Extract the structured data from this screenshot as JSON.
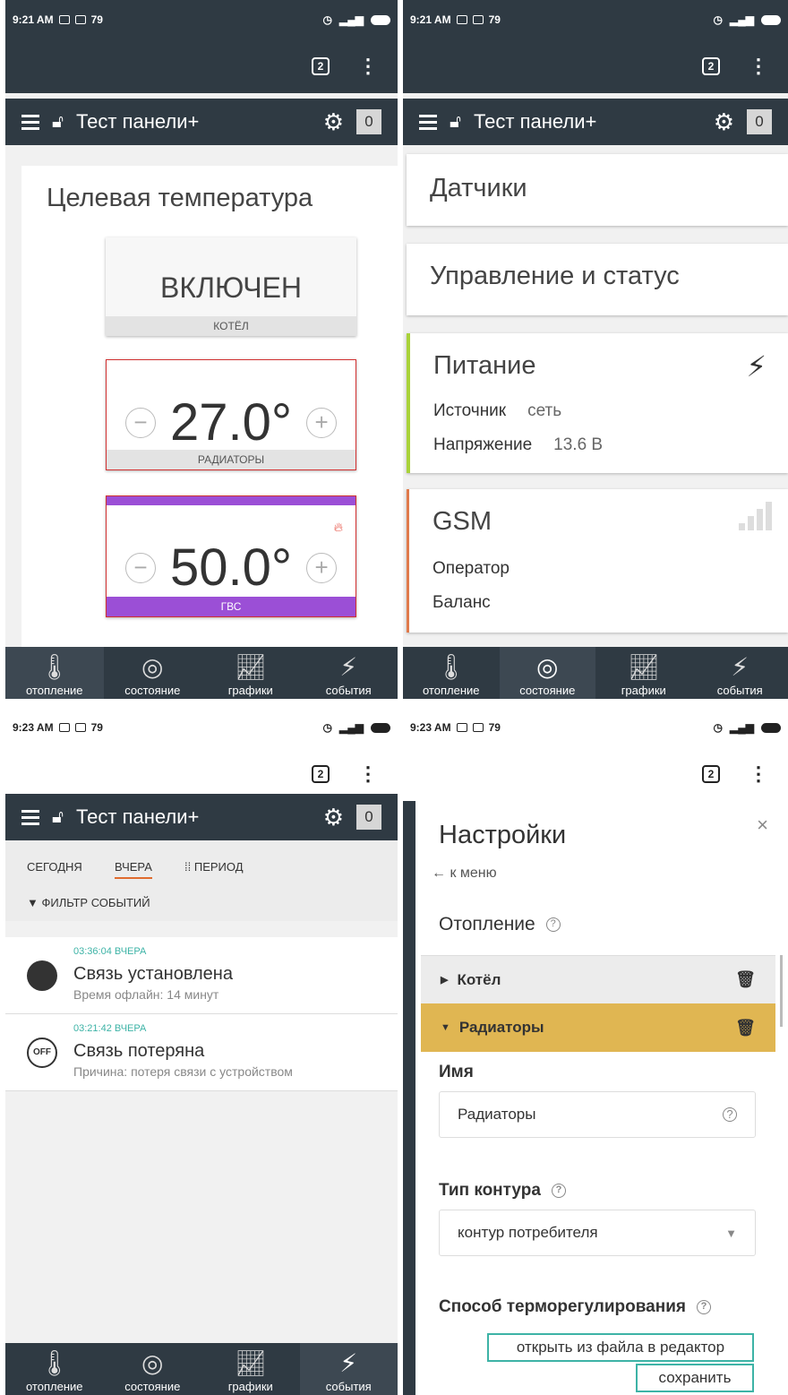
{
  "status": {
    "time_top": "9:21 AM",
    "time_bottom_left": "9:23 AM",
    "time_bottom_right": "9:23 AM",
    "notif": "79"
  },
  "browser": {
    "tabs_count": "2",
    "menu_glyph": "⋮"
  },
  "appbar": {
    "title": "Тест панели+",
    "counter": "0"
  },
  "nav": {
    "items": [
      {
        "label": "отопление",
        "icon": "thermometer-icon"
      },
      {
        "label": "состояние",
        "icon": "circle-icon"
      },
      {
        "label": "графики",
        "icon": "chart-icon"
      },
      {
        "label": "события",
        "icon": "lightning-icon"
      }
    ]
  },
  "heating": {
    "heading": "Целевая температура",
    "boiler_state": "ВКЛЮЧЕН",
    "boiler_label": "КОТЁЛ",
    "radiators_temp": "27.0°",
    "radiators_label": "РАДИАТОРЫ",
    "dhw_temp": "50.0°",
    "dhw_label": "ГВС",
    "minus": "−",
    "plus": "+"
  },
  "state": {
    "sensors": "Датчики",
    "control": "Управление и статус",
    "power_title": "Питание",
    "source_key": "Источник",
    "source_val": "сеть",
    "voltage_key": "Напряжение",
    "voltage_val": "13.6 В",
    "gsm_title": "GSM",
    "operator_key": "Оператор",
    "balance_key": "Баланс"
  },
  "events": {
    "tab_today": "СЕГОДНЯ",
    "tab_yesterday": "ВЧЕРА",
    "tab_period": "ПЕРИОД",
    "filter": "ФИЛЬТР СОБЫТИЙ",
    "list": [
      {
        "time": "03:36:04 ВЧЕРА",
        "title": "Связь установлена",
        "sub": "Время офлайн: 14 минут"
      },
      {
        "time": "03:21:42 ВЧЕРА",
        "title": "Связь потеряна",
        "sub": "Причина: потеря связи с устройством",
        "badge": "OFF"
      }
    ]
  },
  "settings": {
    "title": "Настройки",
    "back": "← к меню",
    "section": "Отопление",
    "acc1": "Котёл",
    "acc2": "Радиаторы",
    "name_label": "Имя",
    "name_value": "Радиаторы",
    "type_label": "Тип контура",
    "type_value": "контур потребителя",
    "method_label": "Способ терморегулирования",
    "open_btn": "открыть из файла в редактор",
    "save_btn": "сохранить",
    "help": "?"
  },
  "colors": {
    "bar": "#2f3a43",
    "accent_red": "#d23030",
    "accent_purple": "#9b4fd6",
    "accent_teal": "#3db3a6",
    "accent_gold": "#e0b652"
  }
}
